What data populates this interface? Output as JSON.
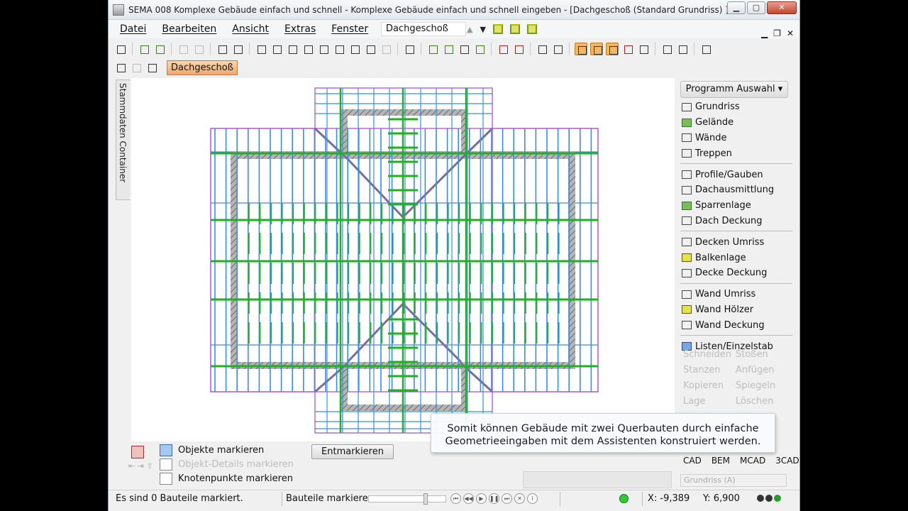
{
  "window": {
    "title": "SEMA  008 Komplexe Gebäude einfach und schnell - Komplexe Gebäude einfach und schnell eingeben  - [Dachgeschoß (Standard Grundriss) ]",
    "minimize": "▁",
    "maximize": "▢",
    "close": "✕"
  },
  "menu": [
    "Datei",
    "Bearbeiten",
    "Ansicht",
    "Extras",
    "Fenster",
    "?"
  ],
  "level_combo": "Dachgeschoß",
  "level_button": "Dachgeschoß",
  "side_tab": "Stammdaten Container",
  "panel": {
    "program_button": "Programm Auswahl ▾",
    "groups": [
      [
        {
          "label": "Grundriss",
          "icon": "floorplan-icon",
          "style": ""
        },
        {
          "label": "Gelände",
          "icon": "terrain-icon",
          "style": "green"
        },
        {
          "label": "Wände",
          "icon": "walls-icon",
          "style": ""
        },
        {
          "label": "Treppen",
          "icon": "stairs-icon",
          "style": ""
        }
      ],
      [
        {
          "label": "Profile/Gauben",
          "icon": "profile-icon",
          "style": ""
        },
        {
          "label": "Dachausmittlung",
          "icon": "roof-icon",
          "style": ""
        },
        {
          "label": "Sparrenlage",
          "icon": "rafter-icon",
          "style": "green"
        },
        {
          "label": "Dach Deckung",
          "icon": "roof-cover-icon",
          "style": ""
        }
      ],
      [
        {
          "label": "Decken Umriss",
          "icon": "ceiling-outline-icon",
          "style": ""
        },
        {
          "label": "Balkenlage",
          "icon": "beam-icon",
          "style": "yellow"
        },
        {
          "label": "Decke Deckung",
          "icon": "ceiling-cover-icon",
          "style": ""
        }
      ],
      [
        {
          "label": "Wand Umriss",
          "icon": "wall-outline-icon",
          "style": ""
        },
        {
          "label": "Wand Hölzer",
          "icon": "wall-timber-icon",
          "style": "yellow"
        },
        {
          "label": "Wand Deckung",
          "icon": "wall-cover-icon",
          "style": ""
        }
      ],
      [
        {
          "label": "Listen/Einzelstab",
          "icon": "list-icon",
          "style": "blue"
        }
      ]
    ],
    "disabled_tools": [
      "Schneiden",
      "Stoßen",
      "Stanzen",
      "Anfügen",
      "Kopieren",
      "Spiegeln",
      "Lage",
      "Löschen"
    ],
    "cad_tabs": [
      "CAD",
      "BEM",
      "MCAD",
      "3CAD"
    ],
    "view_select": "Grundriss  (A)"
  },
  "marking": {
    "objekte": "Objekte markieren",
    "details": "Objekt-Details markieren",
    "knoten": "Knotenpunkte markieren",
    "entmarkieren": "Entmarkieren"
  },
  "tooltip": {
    "line1": "Somit können Gebäude mit zwei Querbauten durch einfache",
    "line2": "Geometrieeingaben mit dem Assistenten konstruiert werden."
  },
  "status": {
    "marked": "Es sind 0 Bauteile markiert.",
    "mode": "Bauteile markieren",
    "x": "X: -9,389",
    "y": "Y: 6,900"
  },
  "colors": {
    "hatch": "#8a8a8a",
    "rafter_blue": "#3a8ee0",
    "beam_green": "#22b022",
    "outline_purple": "#a04cc0",
    "level_button": "#f2a66a"
  }
}
